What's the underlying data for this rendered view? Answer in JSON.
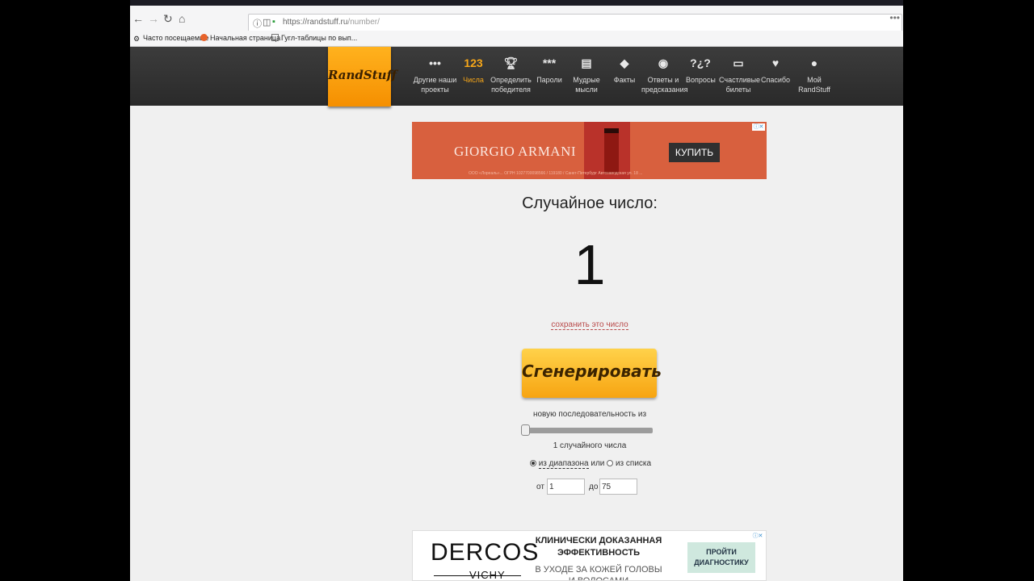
{
  "browser": {
    "url_host": "https://randstuff.ru",
    "url_path": "/number/",
    "bookmarks": [
      "Часто посещаемые",
      "Начальная страница",
      "Гугл-таблицы по вып..."
    ]
  },
  "site": {
    "logo": "RandStuff",
    "nav": [
      {
        "icon": "...",
        "label": "Другие наши\nпроекты"
      },
      {
        "icon": "123",
        "label": "Числа"
      },
      {
        "icon": "trophy",
        "label": "Определить\nпобедителя"
      },
      {
        "icon": "***",
        "label": "Пароли"
      },
      {
        "icon": "book",
        "label": "Мудрые\nмысли"
      },
      {
        "icon": "!",
        "label": "Факты"
      },
      {
        "icon": "8-ball",
        "label": "Ответы и\nпредсказания"
      },
      {
        "icon": "??",
        "label": "Вопросы"
      },
      {
        "icon": "ticket",
        "label": "Счастливые\nбилеты"
      },
      {
        "icon": "heart",
        "label": "Спасибо"
      },
      {
        "icon": "user",
        "label": "Мой\nRandStuff"
      }
    ]
  },
  "ad_top": {
    "brand": "GIORGIO ARMANI",
    "button": "КУПИТЬ",
    "fine_print": "ООО «Лореаль»... ОГРН 1027700098566 / 119180 / Санкт-Петербург Автозаводская ул. 18 ...",
    "marker": "ⓘ✕"
  },
  "main": {
    "title": "Случайное число:",
    "number": "1",
    "save_link": "сохранить это число",
    "generate_button": "Сгенерировать",
    "sequence_label": "новую последовательность из",
    "count_label": "1 случайного числа",
    "slider_value": 1,
    "mode_range": "из диапазона",
    "mode_or": "или",
    "mode_list": "из списка",
    "from_label": "от",
    "from_value": "1",
    "to_label": "до",
    "to_value": "75"
  },
  "ad_bottom": {
    "brand": "DERCOS",
    "sub_brand": "VICHY",
    "headline": "КЛИНИЧЕСКИ ДОКАЗАННАЯ ЭФФЕКТИВНОСТЬ",
    "body": "В УХОДЕ ЗА КОЖЕЙ ГОЛОВЫ И ВОЛОСАМИ",
    "cta": "ПРОЙТИ ДИАГНОСТИКУ",
    "marker": "ⓘ✕"
  },
  "colors": {
    "accent": "#f7a719",
    "header_bg": "#333333",
    "link_red": "#b94a4a"
  }
}
